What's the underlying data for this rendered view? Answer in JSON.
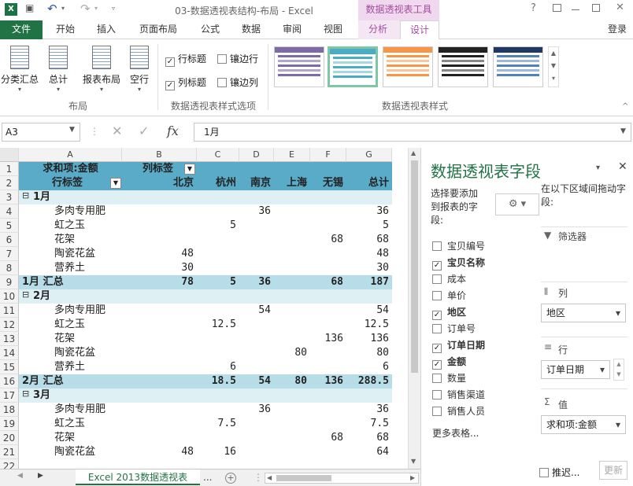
{
  "window": {
    "title": "03-数据透视表结构-布局 - Excel",
    "context_title": "数据透视表工具",
    "app_icon": "X",
    "help": "?",
    "login": "登录"
  },
  "quick_access": {
    "save_icon": "save-icon",
    "undo_icon": "undo-icon",
    "redo_icon": "redo-icon"
  },
  "tabs": {
    "file": "文件",
    "home": "开始",
    "insert": "插入",
    "layout": "页面布局",
    "formula": "公式",
    "data": "数据",
    "review": "审阅",
    "view": "视图",
    "analyze": "分析",
    "design": "设计"
  },
  "ribbon": {
    "btn_subtotal": "分类汇总",
    "btn_total": "总计",
    "btn_report_layout": "报表布局",
    "btn_blank_rows": "空行",
    "group_layout": "布局",
    "opt_row_headers": "行标题",
    "opt_col_headers": "列标题",
    "opt_banded_rows": "镶边行",
    "opt_banded_cols": "镶边列",
    "group_style_options": "数据透视表样式选项",
    "group_styles": "数据透视表样式"
  },
  "formula_bar": {
    "name_box": "A3",
    "formula": "1月",
    "fx": "fx"
  },
  "sheet": {
    "columns": [
      "A",
      "B",
      "C",
      "D",
      "E",
      "F",
      "G"
    ],
    "header": {
      "value_label": "求和项:金额",
      "col_label": "列标签",
      "row_label": "行标签",
      "cities": [
        "北京",
        "杭州",
        "南京",
        "上海",
        "无锡",
        "总计"
      ]
    },
    "rows": [
      {
        "n": "3",
        "type": "group",
        "label": "1月",
        "toggle": "⊟",
        "vals": [
          "",
          "",
          "",
          "",
          "",
          ""
        ]
      },
      {
        "n": "4",
        "type": "item",
        "label": "多肉专用肥",
        "vals": [
          "",
          "",
          "36",
          "",
          "",
          "36"
        ]
      },
      {
        "n": "5",
        "type": "item",
        "label": "虹之玉",
        "vals": [
          "",
          "5",
          "",
          "",
          "",
          "5"
        ]
      },
      {
        "n": "6",
        "type": "item",
        "label": "花架",
        "vals": [
          "",
          "",
          "",
          "",
          "68",
          "68"
        ]
      },
      {
        "n": "7",
        "type": "item",
        "label": "陶瓷花盆",
        "vals": [
          "48",
          "",
          "",
          "",
          "",
          "48"
        ]
      },
      {
        "n": "8",
        "type": "item",
        "label": "营养土",
        "vals": [
          "30",
          "",
          "",
          "",
          "",
          "30"
        ]
      },
      {
        "n": "9",
        "type": "total",
        "label": "1月 汇总",
        "vals": [
          "78",
          "5",
          "36",
          "",
          "68",
          "187"
        ]
      },
      {
        "n": "10",
        "type": "group",
        "label": "2月",
        "toggle": "⊟",
        "vals": [
          "",
          "",
          "",
          "",
          "",
          ""
        ]
      },
      {
        "n": "11",
        "type": "item",
        "label": "多肉专用肥",
        "vals": [
          "",
          "",
          "54",
          "",
          "",
          "54"
        ]
      },
      {
        "n": "12",
        "type": "item",
        "label": "虹之玉",
        "vals": [
          "",
          "12.5",
          "",
          "",
          "",
          "12.5"
        ]
      },
      {
        "n": "13",
        "type": "item",
        "label": "花架",
        "vals": [
          "",
          "",
          "",
          "",
          "136",
          "136"
        ]
      },
      {
        "n": "14",
        "type": "item",
        "label": "陶瓷花盆",
        "vals": [
          "",
          "",
          "",
          "80",
          "",
          "80"
        ]
      },
      {
        "n": "15",
        "type": "item",
        "label": "营养土",
        "vals": [
          "",
          "6",
          "",
          "",
          "",
          "6"
        ]
      },
      {
        "n": "16",
        "type": "total",
        "label": "2月 汇总",
        "vals": [
          "",
          "18.5",
          "54",
          "80",
          "136",
          "288.5"
        ]
      },
      {
        "n": "17",
        "type": "group",
        "label": "3月",
        "toggle": "⊟",
        "vals": [
          "",
          "",
          "",
          "",
          "",
          ""
        ]
      },
      {
        "n": "18",
        "type": "item",
        "label": "多肉专用肥",
        "vals": [
          "",
          "",
          "36",
          "",
          "",
          "36"
        ]
      },
      {
        "n": "19",
        "type": "item",
        "label": "虹之玉",
        "vals": [
          "",
          "7.5",
          "",
          "",
          "",
          "7.5"
        ]
      },
      {
        "n": "20",
        "type": "item",
        "label": "花架",
        "vals": [
          "",
          "",
          "",
          "",
          "68",
          "68"
        ]
      },
      {
        "n": "21",
        "type": "item",
        "label": "陶瓷花盆",
        "vals": [
          "48",
          "16",
          "",
          "",
          "",
          "64"
        ]
      }
    ]
  },
  "sheet_tab": {
    "name": "Excel 2013数据透视表",
    "more": "..."
  },
  "pane": {
    "title": "数据透视表字段",
    "prompt": "选择要添加到报表的字段:",
    "drag_hint": "在以下区域间拖动字段:",
    "fields": [
      {
        "label": "宝贝编号",
        "checked": false
      },
      {
        "label": "宝贝名称",
        "checked": true
      },
      {
        "label": "成本",
        "checked": false
      },
      {
        "label": "单价",
        "checked": false
      },
      {
        "label": "地区",
        "checked": true
      },
      {
        "label": "订单号",
        "checked": false
      },
      {
        "label": "订单日期",
        "checked": true
      },
      {
        "label": "金额",
        "checked": true
      },
      {
        "label": "数量",
        "checked": false
      },
      {
        "label": "销售渠道",
        "checked": false
      },
      {
        "label": "销售人员",
        "checked": false
      }
    ],
    "more_tables": "更多表格...",
    "areas": {
      "filter": "筛选器",
      "columns": "列",
      "rows": "行",
      "values": "值"
    },
    "col_value": "地区",
    "row_value": "订单日期",
    "val_value": "求和项:金额",
    "defer": "推迟...",
    "update": "更新"
  }
}
